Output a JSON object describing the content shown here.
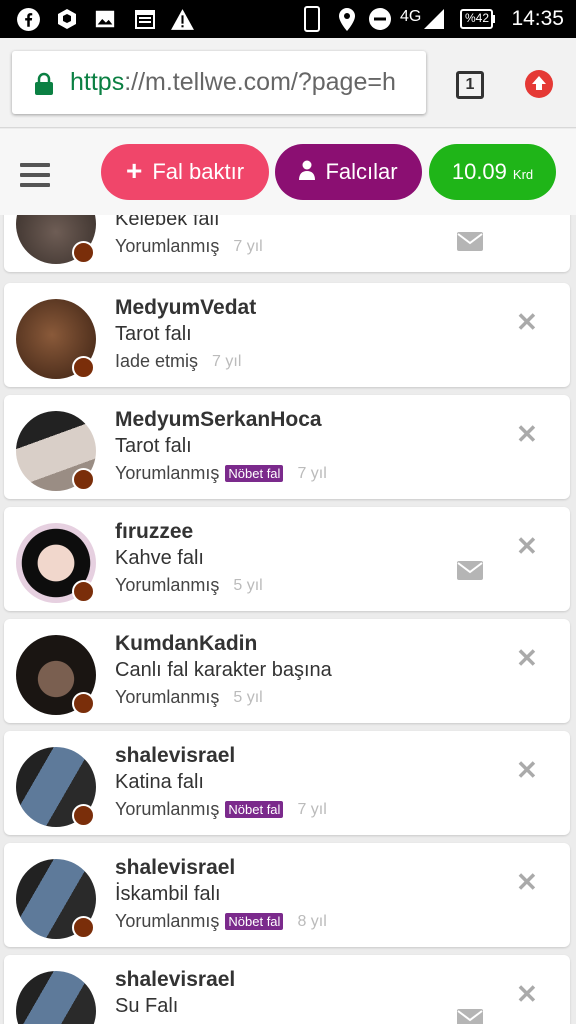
{
  "status_bar": {
    "time": "14:35",
    "network": "4G",
    "battery": "%42",
    "icons": [
      "facebook-icon",
      "bag-icon",
      "image-icon",
      "calendar-icon",
      "warning-icon",
      "phone-icon",
      "location-icon",
      "dnd-icon",
      "signal-icon",
      "battery-icon"
    ]
  },
  "browser": {
    "url_scheme": "https",
    "url_rest": "://m.tellwe.com/?page=h",
    "tab_count": "1"
  },
  "header": {
    "fal_baktir": "Fal baktır",
    "falcilar": "Falcılar",
    "credit_value": "10.09",
    "credit_unit": "Krd"
  },
  "colors": {
    "pink": "#f0466a",
    "purple": "#8b0f72",
    "green": "#1fb518",
    "badge": "#7b2a8c"
  },
  "items": [
    {
      "username": "",
      "fal_type": "Kelebek falı",
      "status": "Yorumlanmış",
      "badge": "",
      "age": "7 yıl",
      "has_mail": true,
      "has_close": false
    },
    {
      "username": "MedyumVedat",
      "fal_type": "Tarot falı",
      "status": "Iade etmiş",
      "badge": "",
      "age": "7 yıl",
      "has_mail": false,
      "has_close": true
    },
    {
      "username": "MedyumSerkanHoca",
      "fal_type": "Tarot falı",
      "status": "Yorumlanmış",
      "badge": "Nöbet fal",
      "age": "7 yıl",
      "has_mail": false,
      "has_close": true
    },
    {
      "username": "fıruzzee",
      "fal_type": "Kahve falı",
      "status": "Yorumlanmış",
      "badge": "",
      "age": "5 yıl",
      "has_mail": true,
      "has_close": true
    },
    {
      "username": "KumdanKadin",
      "fal_type": "Canlı fal karakter başına",
      "status": "Yorumlanmış",
      "badge": "",
      "age": "5 yıl",
      "has_mail": false,
      "has_close": true
    },
    {
      "username": "shalevisrael",
      "fal_type": "Katina falı",
      "status": "Yorumlanmış",
      "badge": "Nöbet fal",
      "age": "7 yıl",
      "has_mail": false,
      "has_close": true
    },
    {
      "username": "shalevisrael",
      "fal_type": "İskambil falı",
      "status": "Yorumlanmış",
      "badge": "Nöbet fal",
      "age": "8 yıl",
      "has_mail": false,
      "has_close": true
    },
    {
      "username": "shalevisrael",
      "fal_type": "Su Falı",
      "status": "",
      "badge": "",
      "age": "",
      "has_mail": true,
      "has_close": true
    }
  ]
}
